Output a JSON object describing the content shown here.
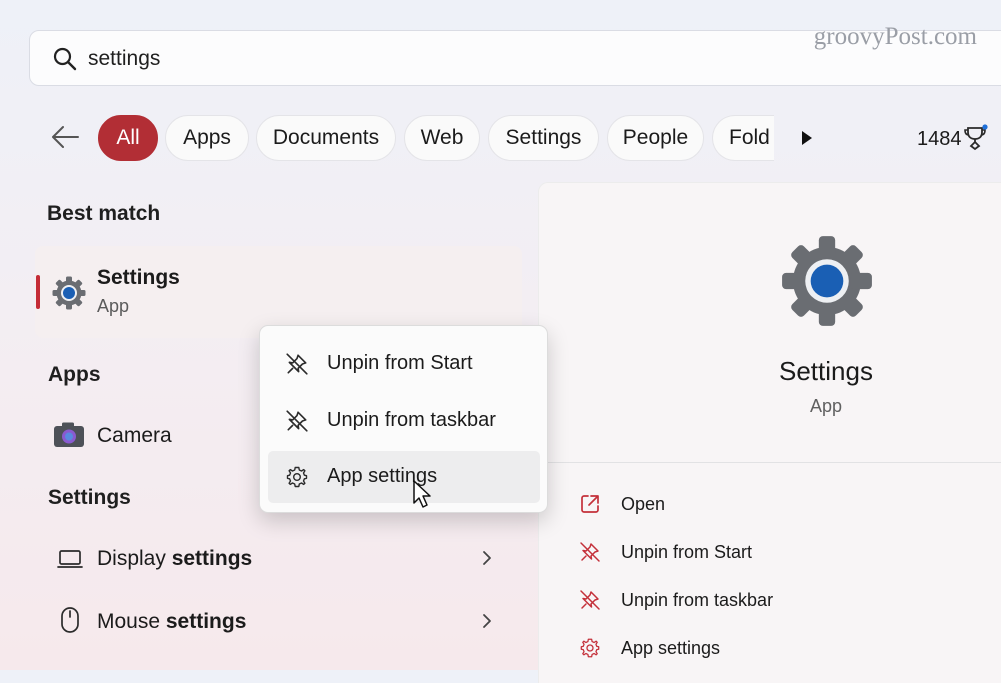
{
  "search": {
    "value": "settings",
    "icon": "search-icon"
  },
  "watermark": "groovyPost.com",
  "filters": {
    "active": "All",
    "chips": [
      "All",
      "Apps",
      "Documents",
      "Web",
      "Settings",
      "People",
      "Fold"
    ],
    "points": "1484"
  },
  "left": {
    "best_match_header": "Best match",
    "best_match": {
      "title": "Settings",
      "subtitle": "App"
    },
    "apps_header": "Apps",
    "apps": [
      {
        "label": "Camera"
      }
    ],
    "settings_header": "Settings",
    "settings": [
      {
        "prefix": "Display ",
        "bold": "settings"
      },
      {
        "prefix": "Mouse ",
        "bold": "settings"
      }
    ]
  },
  "context_menu": {
    "items": [
      "Unpin from Start",
      "Unpin from taskbar",
      "App settings"
    ],
    "highlighted": "App settings"
  },
  "detail": {
    "title": "Settings",
    "subtitle": "App",
    "actions": [
      "Open",
      "Unpin from Start",
      "Unpin from taskbar",
      "App settings"
    ]
  },
  "colors": {
    "accent": "#b22e35",
    "icon_red": "#c4303a",
    "gear_blue": "#1a5fb4"
  }
}
